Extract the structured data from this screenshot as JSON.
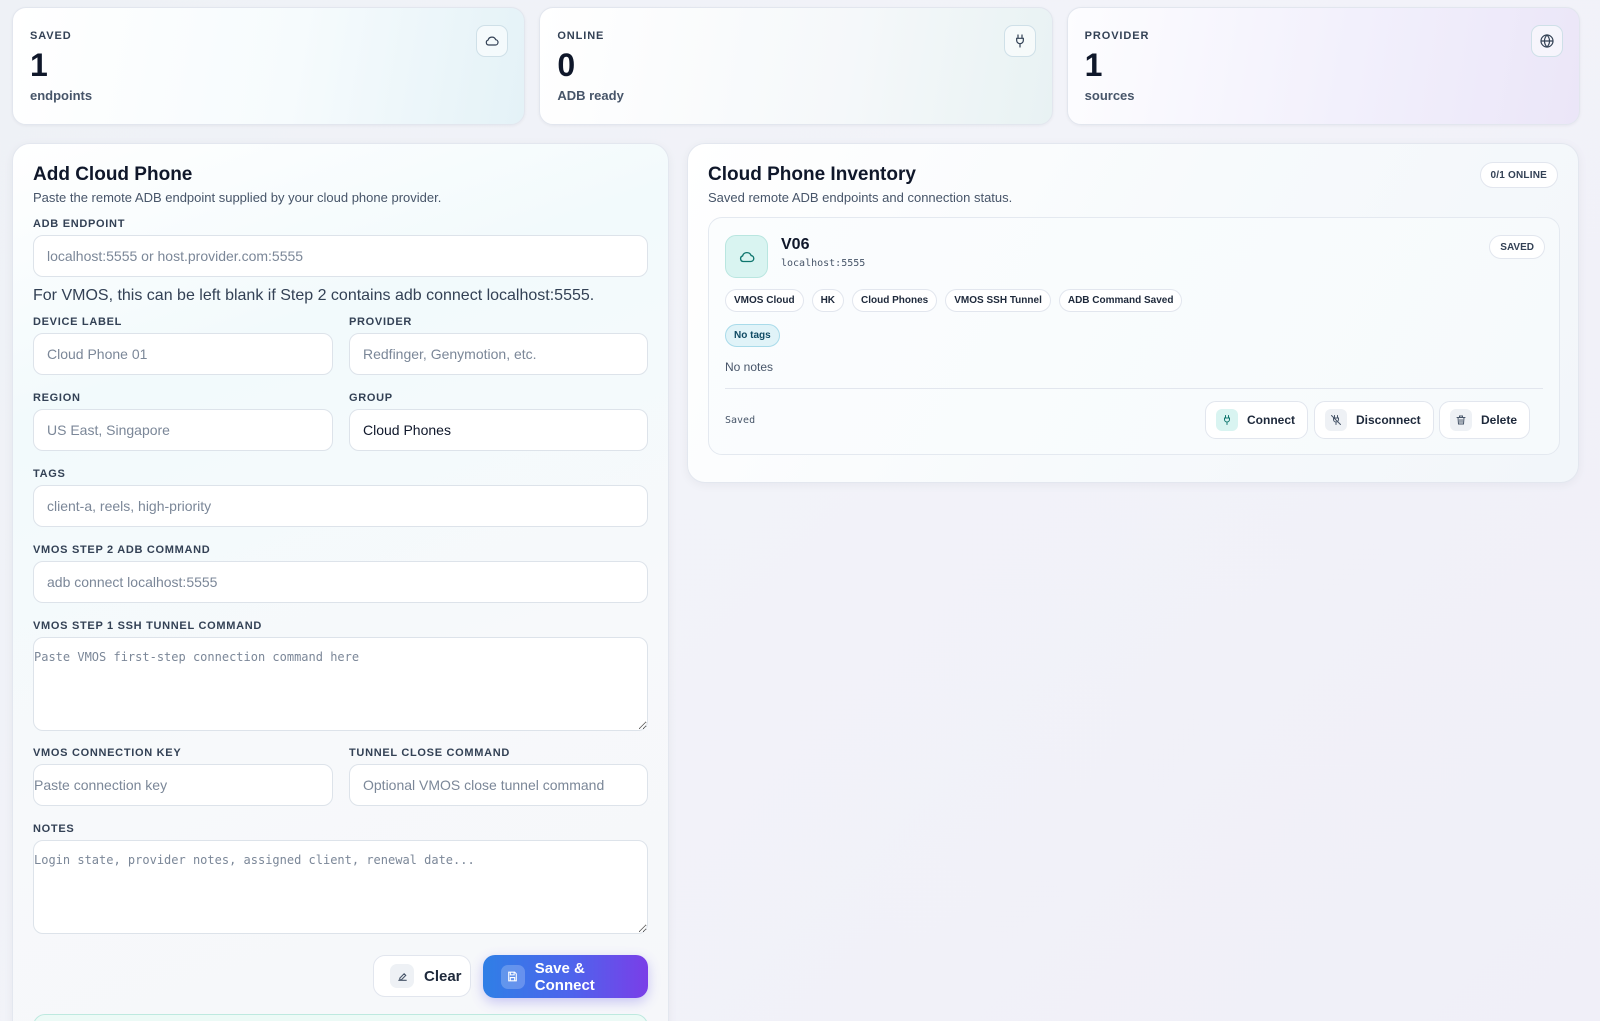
{
  "stats": [
    {
      "label": "SAVED",
      "value": "1",
      "sub": "endpoints",
      "icon": "cloud-icon"
    },
    {
      "label": "ONLINE",
      "value": "0",
      "sub": "ADB ready",
      "icon": "plug-icon"
    },
    {
      "label": "PROVIDER",
      "value": "1",
      "sub": "sources",
      "icon": "globe-icon"
    }
  ],
  "form": {
    "title": "Add Cloud Phone",
    "description": "Paste the remote ADB endpoint supplied by your cloud phone provider.",
    "adb_endpoint": {
      "label": "ADB ENDPOINT",
      "placeholder": "localhost:5555 or host.provider.com:5555",
      "value": ""
    },
    "hint": "For VMOS, this can be left blank if Step 2 contains adb connect localhost:5555.",
    "device_label": {
      "label": "DEVICE LABEL",
      "placeholder": "Cloud Phone 01",
      "value": ""
    },
    "provider": {
      "label": "PROVIDER",
      "placeholder": "Redfinger, Genymotion, etc.",
      "value": ""
    },
    "region": {
      "label": "REGION",
      "placeholder": "US East, Singapore",
      "value": ""
    },
    "group": {
      "label": "GROUP",
      "placeholder": "",
      "value": "Cloud Phones"
    },
    "tags": {
      "label": "TAGS",
      "placeholder": "client-a, reels, high-priority",
      "value": ""
    },
    "step2": {
      "label": "VMOS STEP 2 ADB COMMAND",
      "placeholder": "adb connect localhost:5555",
      "value": ""
    },
    "step1": {
      "label": "VMOS STEP 1 SSH TUNNEL COMMAND",
      "placeholder": "Paste VMOS first-step connection command here",
      "value": ""
    },
    "conn_key": {
      "label": "VMOS CONNECTION KEY",
      "placeholder": "Paste connection key",
      "value": ""
    },
    "close_cmd": {
      "label": "TUNNEL CLOSE COMMAND",
      "placeholder": "Optional VMOS close tunnel command",
      "value": ""
    },
    "notes": {
      "label": "NOTES",
      "placeholder": "Login state, provider notes, assigned client, renewal date...",
      "value": ""
    },
    "clear_label": "Clear",
    "save_label": "Save & Connect"
  },
  "inventory": {
    "title": "Cloud Phone Inventory",
    "description": "Saved remote ADB endpoints and connection status.",
    "online_badge": "0/1 ONLINE",
    "device": {
      "name": "V06",
      "endpoint": "localhost:5555",
      "state_badge": "SAVED",
      "chips": [
        "VMOS Cloud",
        "HK",
        "Cloud Phones",
        "VMOS SSH Tunnel",
        "ADB Command Saved"
      ],
      "tag": "No tags",
      "notes": "No notes",
      "status": "Saved",
      "actions": {
        "connect": "Connect",
        "disconnect": "Disconnect",
        "delete": "Delete"
      }
    }
  },
  "colors": {
    "accent_start": "#2f7fe6",
    "accent_end": "#7a3ee8",
    "teal": "#0d9488"
  }
}
